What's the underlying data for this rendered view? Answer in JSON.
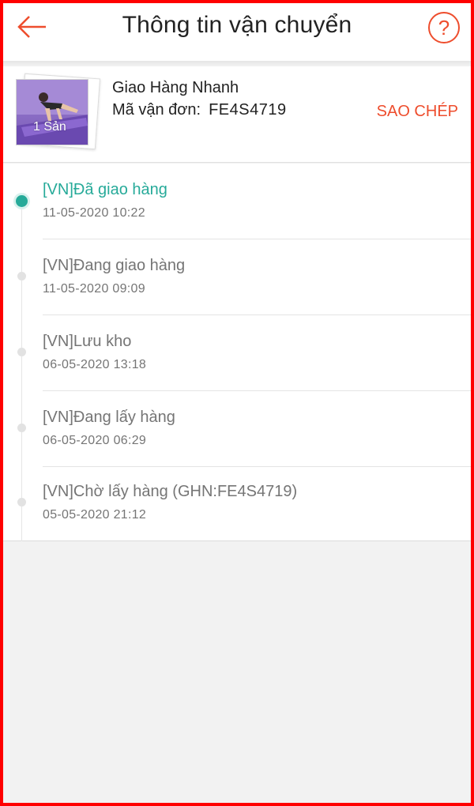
{
  "header": {
    "title": "Thông tin vận chuyển",
    "back_icon": "arrow-left-icon",
    "help_icon": "question-circle-icon",
    "help_glyph": "?",
    "accent": "#ee4d2d"
  },
  "shipment": {
    "carrier": "Giao Hàng Nhanh",
    "tracking_label": "Mã vận đơn:",
    "tracking_code": "FE4S4719",
    "copy_label": "SAO CHÉP",
    "thumbnail_count": "1 Sản"
  },
  "timeline": {
    "active_color": "#26aa99",
    "events": [
      {
        "status": "[VN]Đã giao hàng",
        "time": "11-05-2020 10:22",
        "active": true
      },
      {
        "status": "[VN]Đang giao hàng",
        "time": "11-05-2020 09:09",
        "active": false
      },
      {
        "status": "[VN]Lưu kho",
        "time": "06-05-2020 13:18",
        "active": false
      },
      {
        "status": "[VN]Đang lấy hàng",
        "time": "06-05-2020 06:29",
        "active": false
      },
      {
        "status": "[VN]Chờ lấy hàng (GHN:FE4S4719)",
        "time": "05-05-2020 21:12",
        "active": false
      }
    ]
  }
}
